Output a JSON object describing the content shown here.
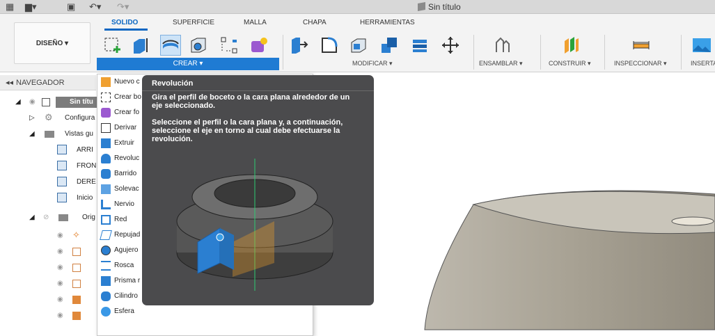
{
  "window": {
    "doc_title": "Sin título"
  },
  "toolbar": {
    "grid_icon": "grid-icon",
    "file_icon": "file-icon",
    "save_icon": "save-icon",
    "undo_icon": "undo-icon",
    "redo_icon": "redo-icon"
  },
  "ribbon": {
    "workspace_label": "DISEÑO ▾",
    "tabs": [
      "SOLIDO",
      "SUPERFICIE",
      "MALLA",
      "CHAPA",
      "HERRAMIENTAS"
    ],
    "active_tab": "SOLIDO",
    "groups": {
      "crear": "CREAR ▾",
      "modificar": "MODIFICAR ▾",
      "ensamblar": "ENSAMBLAR ▾",
      "construir": "CONSTRUIR ▾",
      "inspeccionar": "INSPECCIONAR ▾",
      "insertar": "INSERTA"
    },
    "accent_color": "#1f7bd3"
  },
  "navigator": {
    "header": "NAVEGADOR",
    "items": [
      {
        "label": "Sin títu"
      },
      {
        "label": "Configura"
      },
      {
        "label": "Vistas gu"
      },
      {
        "label": "ARRI"
      },
      {
        "label": "FRON"
      },
      {
        "label": "DERE"
      },
      {
        "label": "Inicio"
      },
      {
        "label": "Orig"
      },
      {
        "label": ""
      },
      {
        "label": ""
      },
      {
        "label": ""
      },
      {
        "label": ""
      },
      {
        "label": ""
      },
      {
        "label": ""
      }
    ]
  },
  "crear_menu": {
    "items": [
      {
        "label": "Nuevo c"
      },
      {
        "label": "Crear bo"
      },
      {
        "label": "Crear fo"
      },
      {
        "label": "Derivar"
      },
      {
        "label": "Extruir"
      },
      {
        "label": "Revoluc"
      },
      {
        "label": "Barrido"
      },
      {
        "label": "Solevac"
      },
      {
        "label": "Nervio"
      },
      {
        "label": "Red"
      },
      {
        "label": "Repujad"
      },
      {
        "label": "Agujero"
      },
      {
        "label": "Rosca"
      },
      {
        "label": "Prisma r"
      },
      {
        "label": "Cilindro"
      },
      {
        "label": "Esfera"
      }
    ]
  },
  "tooltip": {
    "title": "Revolución",
    "line1": "Gira el perfil de boceto o la cara plana alrededor de un eje seleccionado.",
    "line2": "Seleccione el perfil o la cara plana y, a continuación, seleccione el eje en torno al cual debe efectuarse la revolución."
  }
}
